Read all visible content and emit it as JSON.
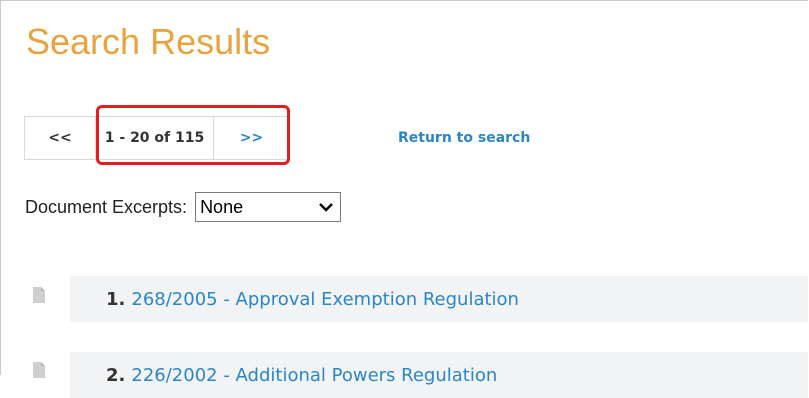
{
  "page": {
    "title": "Search Results"
  },
  "pager": {
    "prev_label": "<<",
    "range_label": "1 - 20 of 115",
    "next_label": ">>",
    "return_label": "Return to search"
  },
  "excerpts": {
    "label": "Document Excerpts:",
    "selected": "None"
  },
  "results": [
    {
      "number": "1.",
      "title": "268/2005 - Approval Exemption Regulation"
    },
    {
      "number": "2.",
      "title": "226/2002 - Additional Powers Regulation"
    }
  ],
  "colors": {
    "title": "#e8a33c",
    "link": "#2b86c5",
    "highlight": "#e02020",
    "row_background": "#f2f3f4"
  },
  "icons": {
    "result_icon": "document-icon",
    "select_arrow": "chevron-down-icon"
  }
}
